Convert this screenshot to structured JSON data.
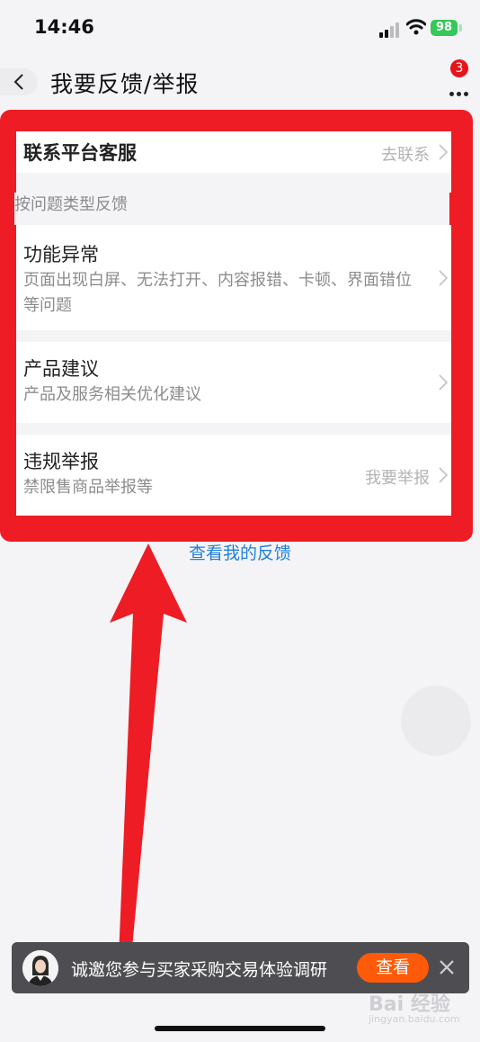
{
  "status_bar": {
    "time": "14:46",
    "battery": "98"
  },
  "nav": {
    "title": "我要反馈/举报",
    "badge_count": "3"
  },
  "contact_row": {
    "title": "联系平台客服",
    "action": "去联系"
  },
  "section_label": "按问题类型反馈",
  "feedback_items": [
    {
      "title": "功能异常",
      "desc": "页面出现白屏、无法打开、内容报错、卡顿、界面错位等问题"
    },
    {
      "title": "产品建议",
      "desc": "产品及服务相关优化建议"
    },
    {
      "title": "违规举报",
      "desc": "禁限售商品举报等",
      "action": "我要举报"
    }
  ],
  "view_feedback_link": "查看我的反馈",
  "survey_banner": {
    "text": "诚邀您参与买家采购交易体验调研",
    "button": "查看"
  },
  "watermark": {
    "main": "Bai 经验",
    "sub": "jingyan.baidu.com"
  },
  "colors": {
    "highlight": "#ee1c25",
    "link": "#2180d8",
    "banner_button": "#ff5a09",
    "badge": "#e5151c"
  }
}
